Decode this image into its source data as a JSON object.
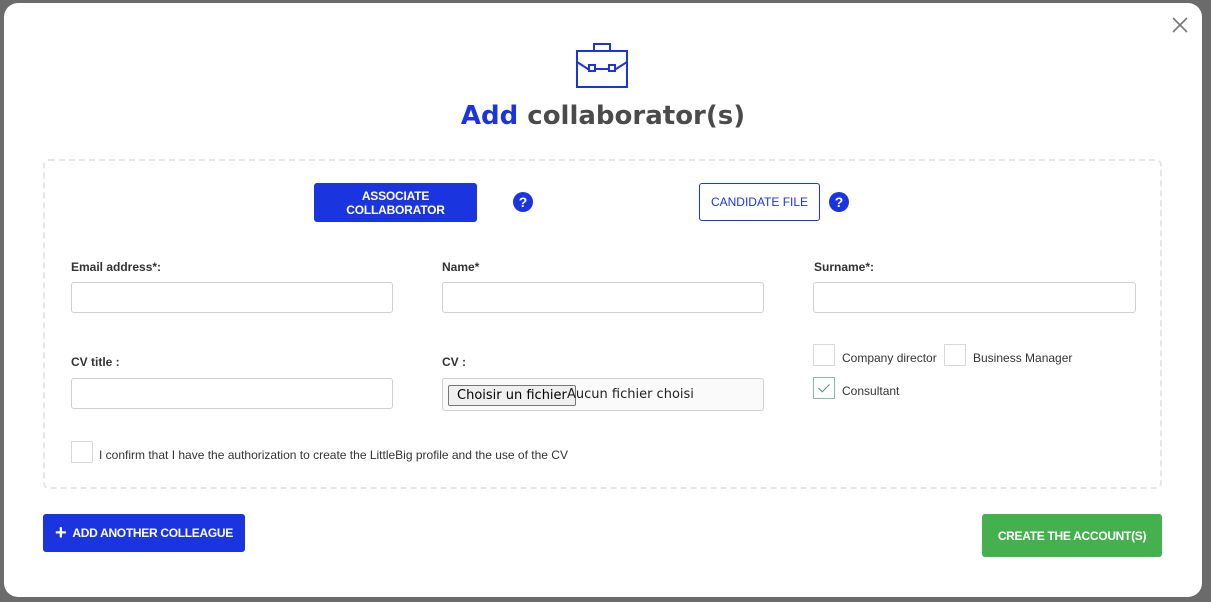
{
  "title": {
    "accent": "Add",
    "rest": " collaborator(s)"
  },
  "icons": {
    "header": "briefcase-icon",
    "close": "close-icon",
    "help": "question-circle-icon",
    "add": "plus-icon"
  },
  "buttons": {
    "associate": "ASSOCIATE COLLABORATOR",
    "candidate": "CANDIDATE FILE",
    "help": "?",
    "add_colleague": "ADD ANOTHER COLLEAGUE",
    "add_plus": "+",
    "create": "CREATE THE ACCOUNT(S)"
  },
  "fields": {
    "email": {
      "label": "Email address*:",
      "value": ""
    },
    "name": {
      "label": "Name*",
      "value": ""
    },
    "surname": {
      "label": "Surname*:",
      "value": ""
    },
    "cv_title": {
      "label": "CV title :",
      "value": ""
    },
    "cv": {
      "label": "CV :",
      "button": "Choisir un fichier",
      "status": "Aucun fichier choisi"
    }
  },
  "roles": [
    {
      "label": "Company director",
      "checked": false
    },
    {
      "label": "Business Manager",
      "checked": false
    },
    {
      "label": "Consultant",
      "checked": true
    }
  ],
  "confirm": {
    "label": "I confirm that I have the authorization to create the LittleBig profile and the use of the CV",
    "checked": false
  },
  "colors": {
    "accent": "#1a35e0",
    "success": "#45b04e",
    "title": "#4b4b4b"
  }
}
